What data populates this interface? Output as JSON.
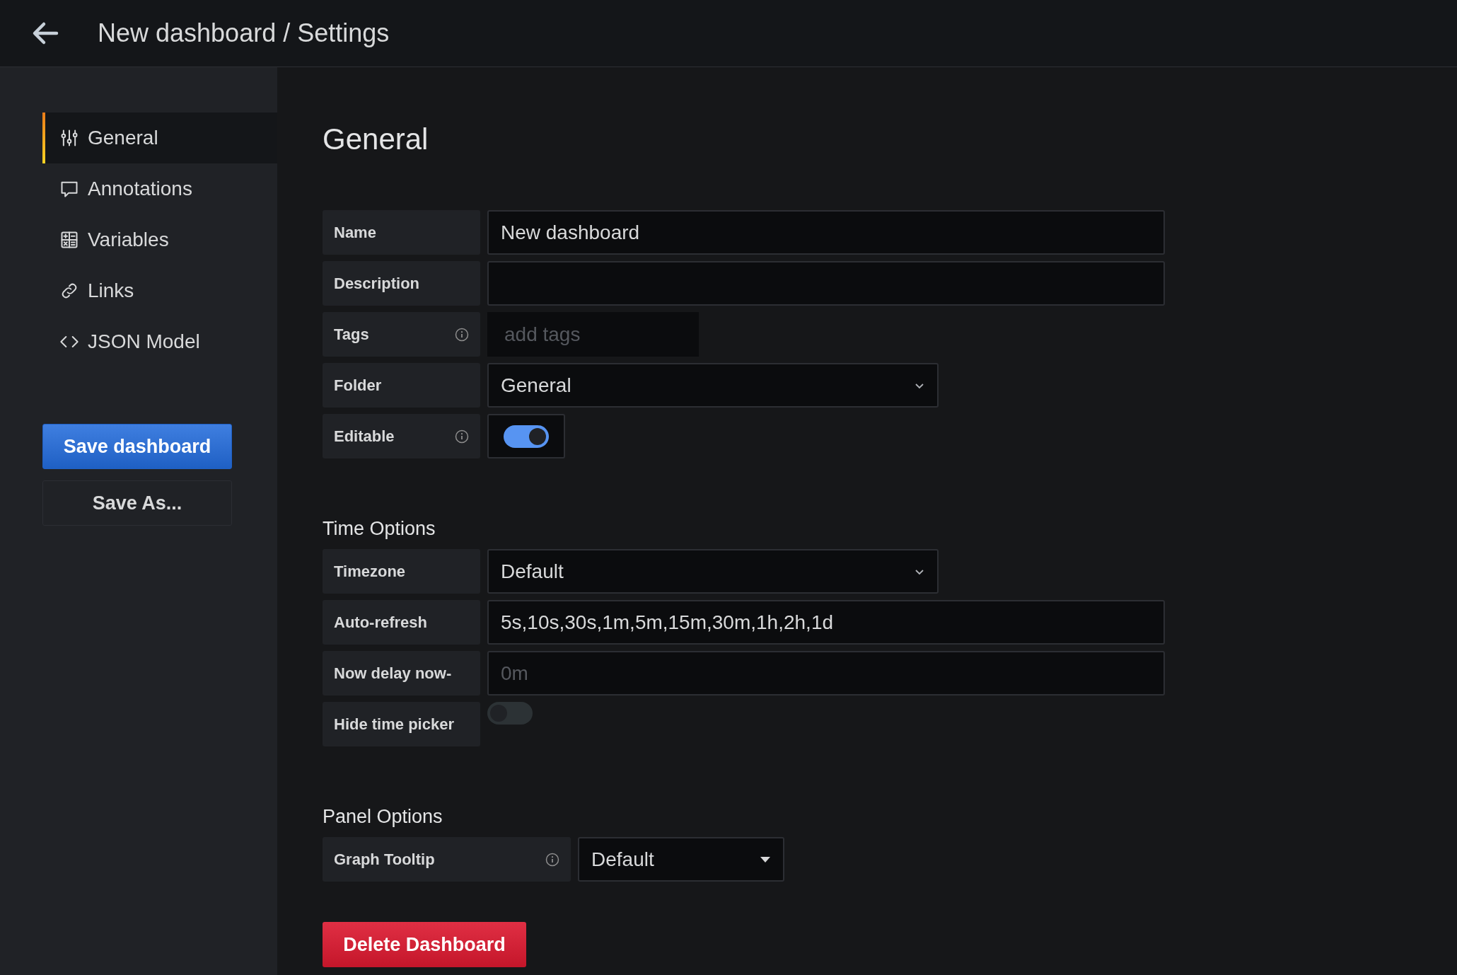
{
  "header": {
    "title": "New dashboard / Settings"
  },
  "sidebar": {
    "items": [
      {
        "label": "General",
        "selected": true
      },
      {
        "label": "Annotations",
        "selected": false
      },
      {
        "label": "Variables",
        "selected": false
      },
      {
        "label": "Links",
        "selected": false
      },
      {
        "label": "JSON Model",
        "selected": false
      }
    ],
    "buttons": [
      {
        "label": "Save dashboard",
        "kind": "primary"
      },
      {
        "label": "Save As...",
        "kind": "secondary"
      }
    ]
  },
  "main": {
    "title": "General",
    "sections": [
      {
        "fields": [
          {
            "label": "Name",
            "info": false,
            "kind": "text",
            "value": "New dashboard"
          },
          {
            "label": "Description",
            "info": false,
            "kind": "text"
          },
          {
            "label": "Tags",
            "info": true,
            "kind": "tags",
            "placeholder": "add tags"
          },
          {
            "label": "Folder",
            "info": false,
            "kind": "select",
            "value": "General"
          },
          {
            "label": "Editable",
            "info": true,
            "kind": "boxtoggle",
            "on": true
          }
        ]
      },
      {
        "title": "Time Options",
        "fields": [
          {
            "label": "Timezone",
            "info": false,
            "kind": "select",
            "value": "Default"
          },
          {
            "label": "Auto-refresh",
            "info": false,
            "kind": "text",
            "value": "5s,10s,30s,1m,5m,15m,30m,1h,2h,1d"
          },
          {
            "label": "Now delay now-",
            "info": false,
            "kind": "text",
            "placeholder": "0m"
          },
          {
            "label": "Hide time picker",
            "info": false,
            "kind": "toggle",
            "on": false
          }
        ]
      },
      {
        "title": "Panel Options",
        "fields": [
          {
            "label": "Graph Tooltip",
            "info": true,
            "kind": "dropdown",
            "value": "Default"
          }
        ]
      }
    ],
    "delete_button": "Delete Dashboard"
  }
}
